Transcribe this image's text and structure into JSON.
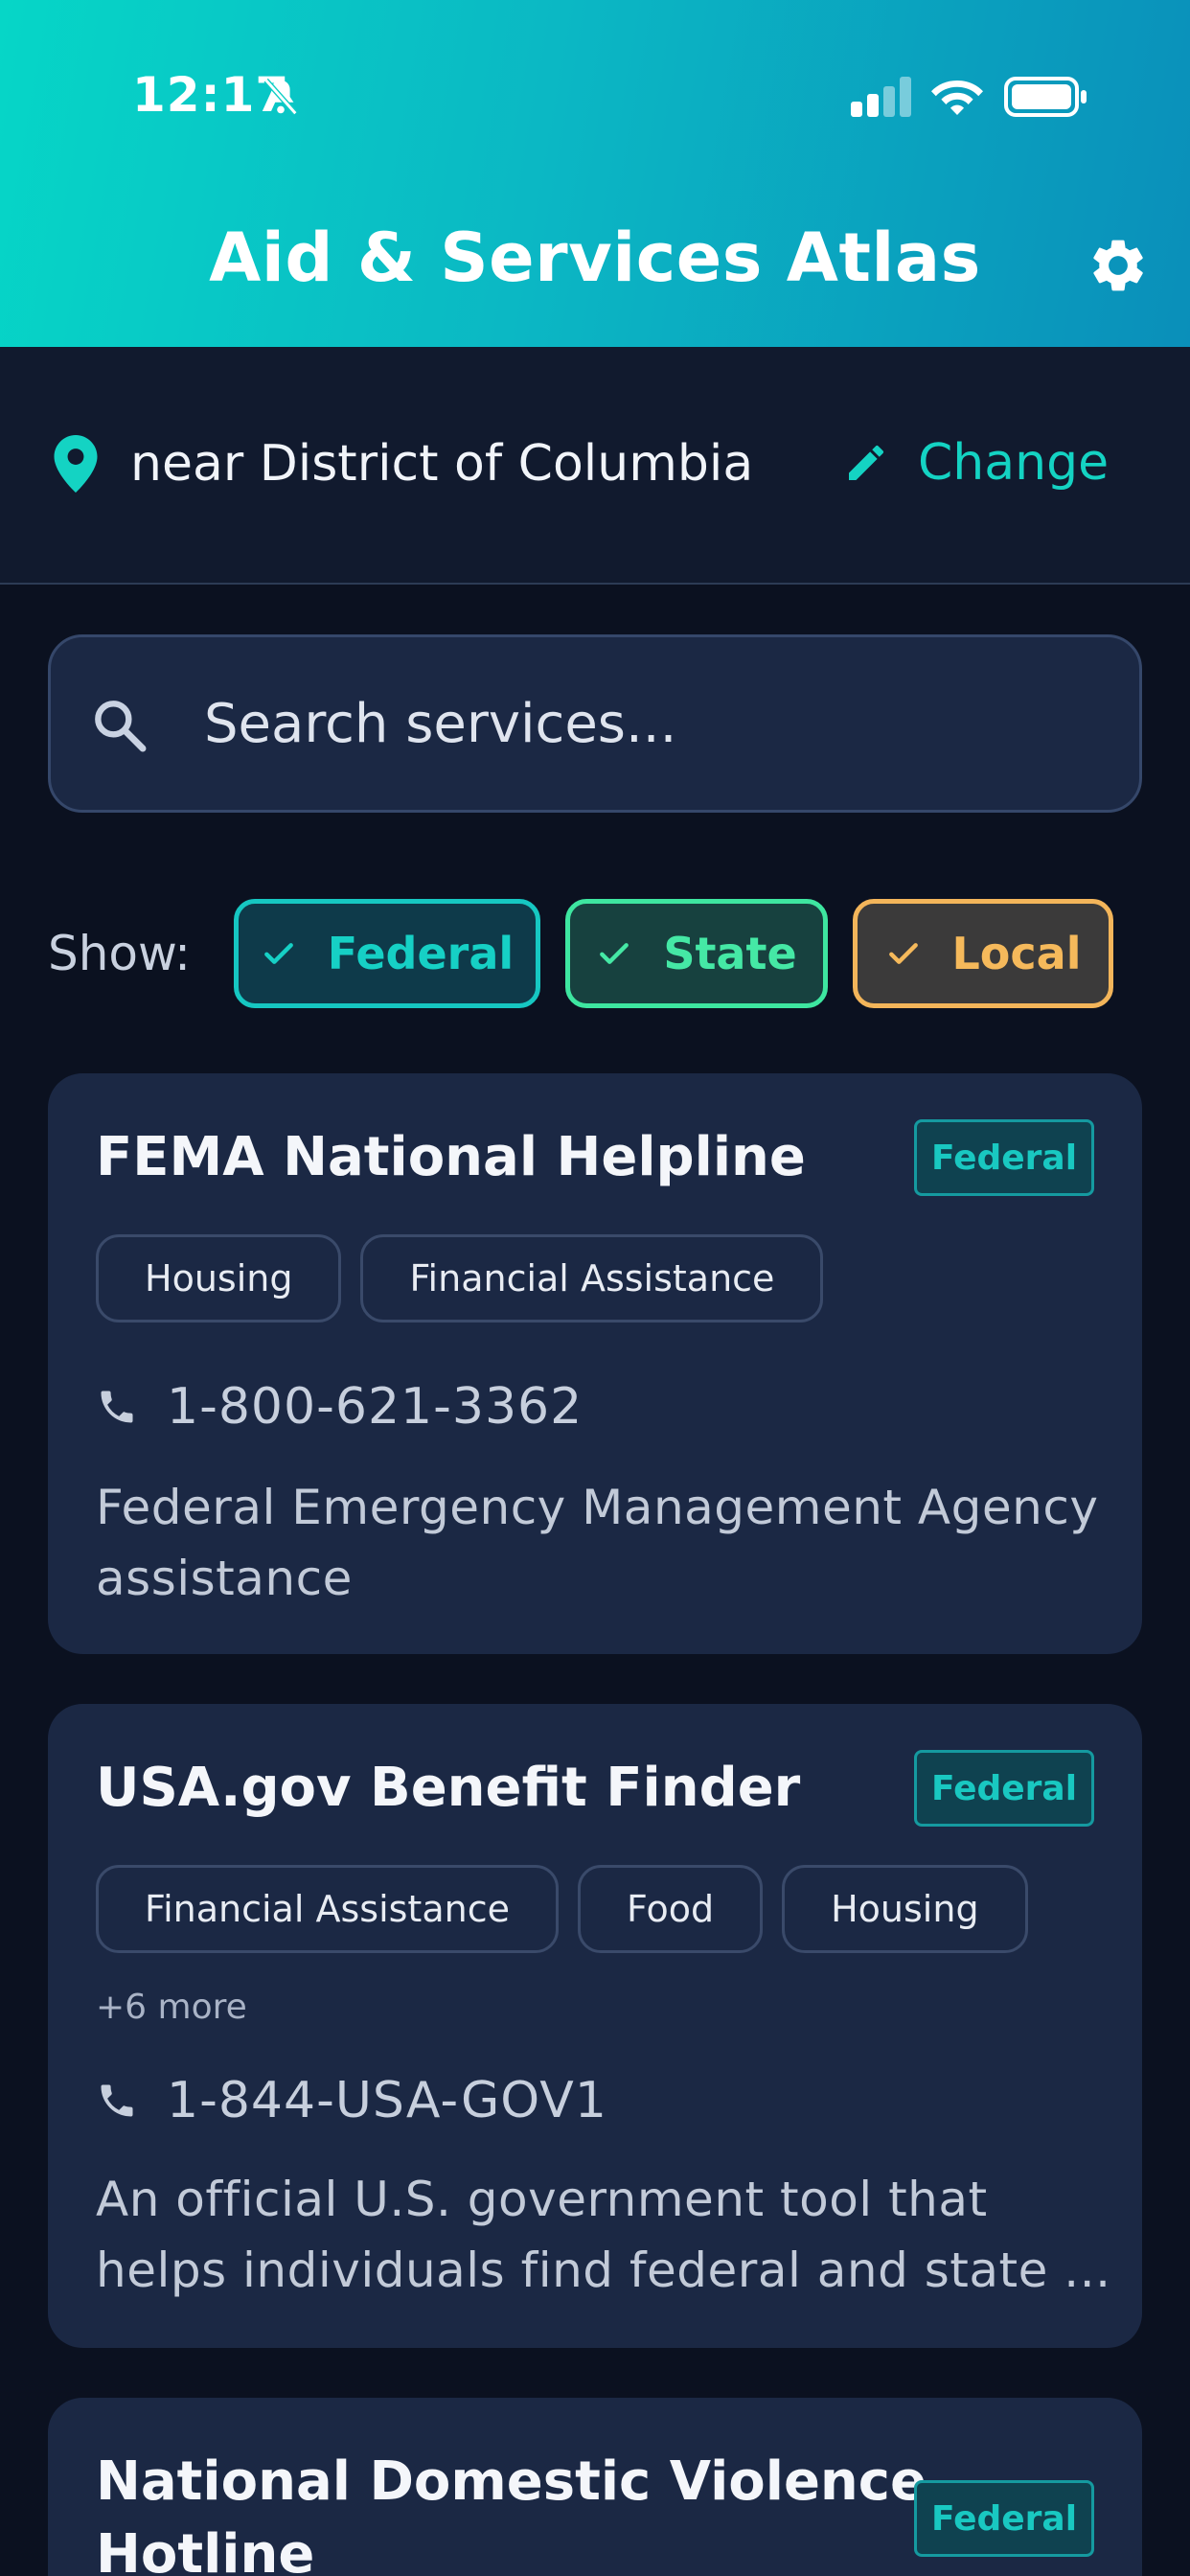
{
  "status_bar": {
    "time": "12:17"
  },
  "header": {
    "title": "Aid & Services Atlas"
  },
  "location": {
    "text": "near District of Columbia",
    "change_label": "Change"
  },
  "search": {
    "placeholder": "Search services..."
  },
  "filters": {
    "label": "Show:",
    "chips": [
      {
        "label": "Federal",
        "checked": true,
        "color": "#16d0c5"
      },
      {
        "label": "State",
        "checked": true,
        "color": "#45e8a5"
      },
      {
        "label": "Local",
        "checked": true,
        "color": "#f5b95b"
      }
    ]
  },
  "services": [
    {
      "title": "FEMA National Helpline",
      "badge": "Federal",
      "tags": [
        "Housing",
        "Financial Assistance"
      ],
      "phone": "1-800-621-3362",
      "description_line1": "Federal Emergency Management Agency",
      "description_line2": "assistance"
    },
    {
      "title": "USA.gov Benefit Finder",
      "badge": "Federal",
      "tags": [
        "Financial Assistance",
        "Food",
        "Housing"
      ],
      "more": "+6 more",
      "phone": "1-844-USA-GOV1",
      "description_line1": "An official U.S. government tool that",
      "description_line2": "helps individuals find federal and state ..."
    },
    {
      "title_line1": "National Domestic Violence",
      "title_line2": "Hotline",
      "badge": "Federal"
    }
  ],
  "colors": {
    "accent": "#14d3c3",
    "background": "#0b1120",
    "card": "#1b2844",
    "header_gradient_start": "#06d6c7",
    "header_gradient_end": "#0a8fba"
  }
}
